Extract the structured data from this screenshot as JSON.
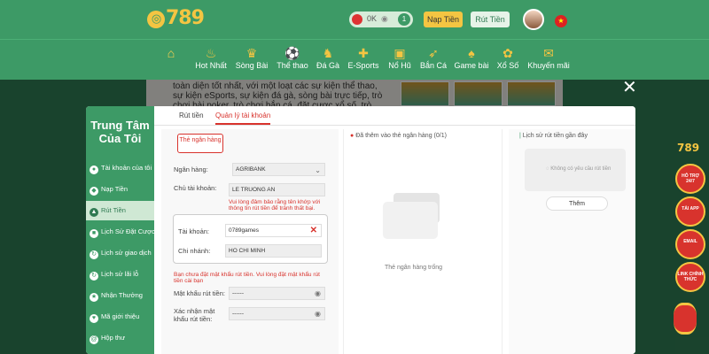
{
  "header": {
    "logo_text": "789",
    "balance_value": "0K",
    "balance_count": "1",
    "deposit_label": "Nạp Tiền",
    "withdraw_label": "Rút Tiền"
  },
  "nav": [
    {
      "label": "",
      "icon": "home-icon"
    },
    {
      "label": "Hot Nhất",
      "icon": "fire-icon"
    },
    {
      "label": "Sòng Bài",
      "icon": "casino-icon"
    },
    {
      "label": "Thể thao",
      "icon": "soccer-icon"
    },
    {
      "label": "Đá Gà",
      "icon": "rooster-icon"
    },
    {
      "label": "E-Sports",
      "icon": "gamepad-icon"
    },
    {
      "label": "Nổ Hũ",
      "icon": "slot-icon"
    },
    {
      "label": "Bắn Cá",
      "icon": "fish-icon"
    },
    {
      "label": "Game bài",
      "icon": "cards-icon"
    },
    {
      "label": "Xổ Số",
      "icon": "lottery-icon"
    },
    {
      "label": "Khuyến mãi",
      "icon": "gift-icon"
    }
  ],
  "background_text": "toàn diện tốt nhất, với một loạt các sự kiện thể thao, sự kiện eSports, sự kiện đá gà, sòng bài trực tiếp, trò chơi bài poker, trò chơi bắn cá, đặt cược xổ số, trò chơi nổ hũ và nhiều hơn",
  "sidebar": {
    "title": "Trung Tâm Của Tôi",
    "items": [
      {
        "label": "Tài khoản của tôi",
        "icon": "user-icon"
      },
      {
        "label": "Nạp Tiền",
        "icon": "deposit-icon"
      },
      {
        "label": "Rút Tiền",
        "icon": "withdraw-icon"
      },
      {
        "label": "Lịch Sử Đặt Cược",
        "icon": "history-icon"
      },
      {
        "label": "Lịch sử giao dịch",
        "icon": "transaction-icon"
      },
      {
        "label": "Lịch sử lãi lỗ",
        "icon": "profit-icon"
      },
      {
        "label": "Nhận Thưởng",
        "icon": "reward-icon"
      },
      {
        "label": "Mã giới thiệu",
        "icon": "referral-icon"
      },
      {
        "label": "Hộp thư",
        "icon": "mail-icon"
      }
    ]
  },
  "tabs": [
    {
      "label": "Rút tiền"
    },
    {
      "label": "Quản lý tài khoản"
    }
  ],
  "form": {
    "card_button": "Thẻ ngân hàng",
    "bank_label": "Ngân hàng:",
    "bank_value": "AGRIBANK",
    "owner_label": "Chủ tài khoản:",
    "owner_value": "LE TRUONG AN",
    "owner_warning": "Vui lòng đảm bảo rằng tên khớp với thông tin rút tiền để tránh thất bại.",
    "account_label": "Tài khoản:",
    "account_value": "0789games",
    "branch_label": "Chi nhánh:",
    "branch_value": "HO CHI MINH",
    "password_warning": "Bạn chưa đặt mật khẩu rút tiền. Vui lòng đặt mật khẩu rút tiền cài bạn",
    "password_label": "Mật khẩu rút tiền:",
    "password_value": "------",
    "confirm_label": "Xác nhận mật khẩu rút tiền:",
    "confirm_value": "------"
  },
  "bank_list": {
    "title": "Đã thêm vào thẻ ngân hàng  (0/1)",
    "empty_text": "Thẻ ngân hàng trống"
  },
  "history": {
    "title": "Lịch sử rút tiền gần đây",
    "empty_text": "Không có yêu cầu rút tiền",
    "add_button": "Thêm"
  },
  "promos": {
    "logo": "789",
    "items": [
      "HỖ TRỢ 24/7",
      "TẢI APP",
      "EMAIL",
      "LINK CHÍNH THỨC"
    ]
  },
  "colors": {
    "brand_green": "#3d9a66",
    "accent_red": "#d8332d",
    "gold": "#f4c542"
  }
}
